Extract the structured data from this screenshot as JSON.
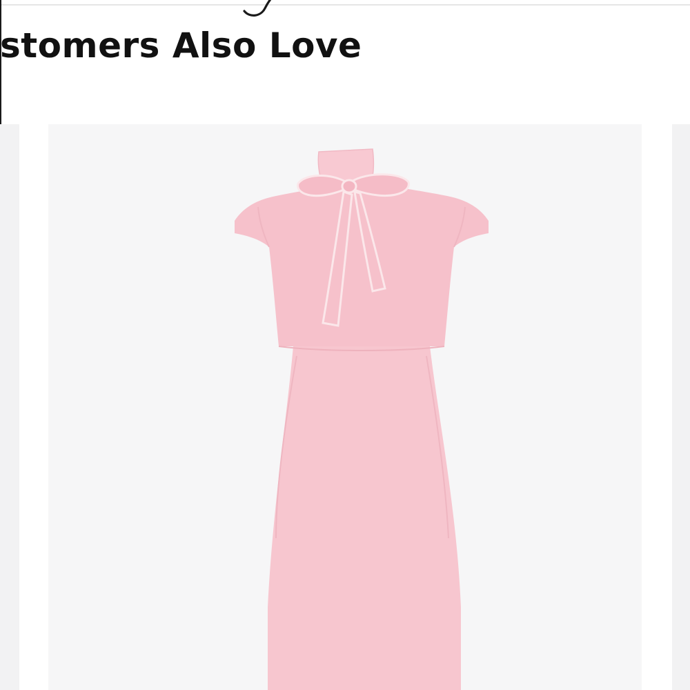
{
  "section": {
    "heading": "stomers Also Love"
  },
  "carousel": {
    "items": [
      {
        "image_icon": "pink-tie-neck-dress-image",
        "dress_color": "#f7c6cf",
        "trim_color": "#fbe7ea"
      }
    ]
  },
  "icons": {
    "logo": "script-logo-fragment"
  }
}
